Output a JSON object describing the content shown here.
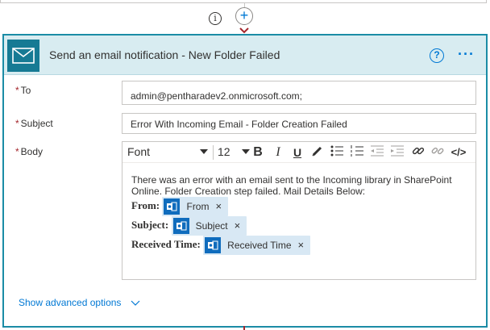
{
  "card": {
    "title": "Send an email notification - New Folder Failed",
    "accent_color": "#1b8ca6",
    "header_bg": "#d8ecf1",
    "icon": "mail-icon"
  },
  "fields": {
    "to": {
      "label": "To",
      "required_mark": "*",
      "value": "admin@pentharadev2.onmicrosoft.com;"
    },
    "subject": {
      "label": "Subject",
      "required_mark": "*",
      "value": "Error With Incoming Email - Folder Creation Failed"
    },
    "body": {
      "label": "Body",
      "required_mark": "*"
    }
  },
  "toolbar": {
    "font": "Font",
    "size": "12",
    "buttons": [
      "bold-icon",
      "italic-icon",
      "underline-icon",
      "highlight-pen-icon",
      "bulleted-list-icon",
      "numbered-list-icon",
      "decrease-indent-icon",
      "increase-indent-icon",
      "link-icon",
      "unlink-icon",
      "code-view-icon"
    ]
  },
  "body_text": {
    "line1": "There was an error with an email sent to the Incoming library in SharePoint Online. Folder Creation step failed. Mail Details Below:",
    "from_label": "From:",
    "subject_label": "Subject:",
    "received_label": "Received Time:"
  },
  "tokens": {
    "from": "From",
    "subject": "Subject",
    "received": "Received Time",
    "remove_glyph": "×",
    "icon": "outlook-icon"
  },
  "footer": {
    "advanced_options": "Show advanced options"
  },
  "glyphs": {
    "info": "i",
    "plus": "+",
    "help": "?",
    "more": "···"
  }
}
